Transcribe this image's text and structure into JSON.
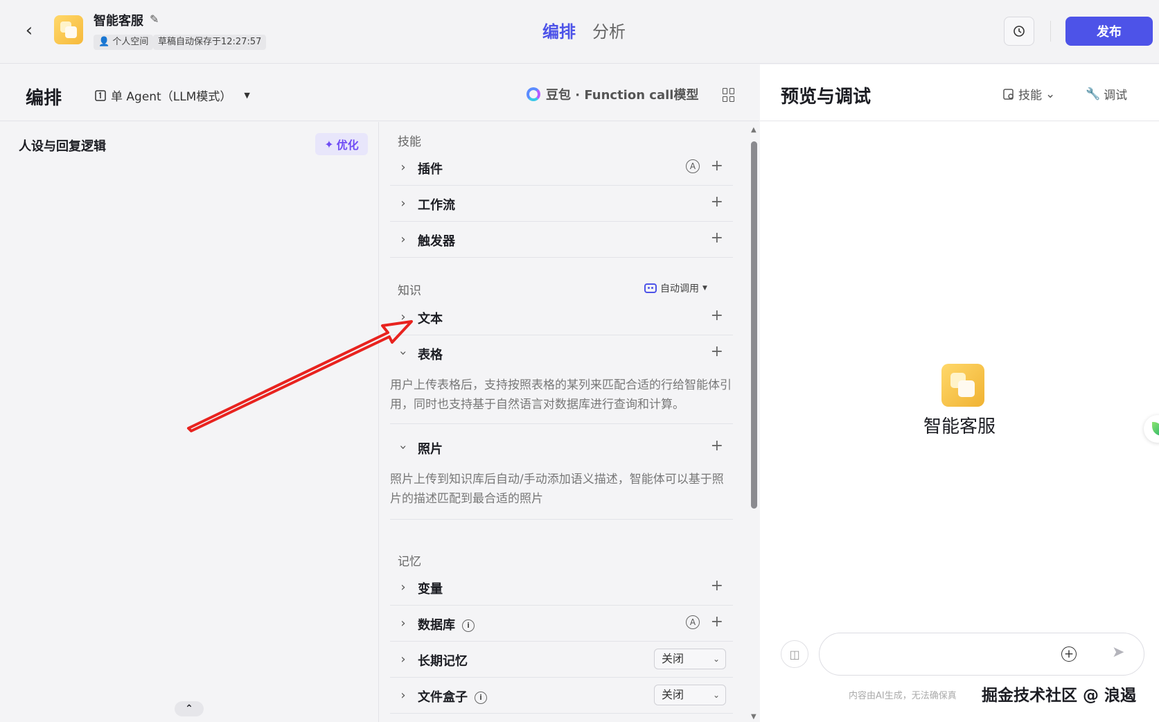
{
  "header": {
    "app_name": "智能客服",
    "space_tag": "个人空间",
    "save_status": "草稿自动保存于12:27:57",
    "tabs": [
      {
        "label": "编排",
        "active": true
      },
      {
        "label": "分析",
        "active": false
      }
    ],
    "publish_label": "发布",
    "accent_color": "#4d53e8"
  },
  "editor": {
    "title": "编排",
    "mode_label": "单 Agent（LLM模式）",
    "model_label": "豆包 · Function call模型"
  },
  "persona": {
    "title": "人设与回复逻辑",
    "optimize_label": "优化"
  },
  "skills": {
    "section_label": "技能",
    "items": [
      {
        "name": "插件"
      },
      {
        "name": "工作流"
      },
      {
        "name": "触发器"
      }
    ]
  },
  "knowledge": {
    "section_label": "知识",
    "auto_call_label": "自动调用",
    "items": [
      {
        "name": "文本"
      },
      {
        "name": "表格",
        "description": "用户上传表格后，支持按照表格的某列来匹配合适的行给智能体引用，同时也支持基于自然语言对数据库进行查询和计算。"
      },
      {
        "name": "照片",
        "description": "照片上传到知识库后自动/手动添加语义描述，智能体可以基于照片的描述匹配到最合适的照片"
      }
    ]
  },
  "memory": {
    "section_label": "记忆",
    "items": [
      {
        "name": "变量"
      },
      {
        "name": "数据库"
      },
      {
        "name": "长期记忆",
        "value": "关闭"
      },
      {
        "name": "文件盒子",
        "value": "关闭"
      }
    ]
  },
  "preview": {
    "title": "预览与调试",
    "skills_btn": "技能",
    "debug_btn": "调试",
    "bot_name": "智能客服",
    "input_placeholder": "",
    "disclaimer": "内容由AI生成，无法确保真",
    "watermark": "掘金技术社区 @ 浪遏"
  }
}
